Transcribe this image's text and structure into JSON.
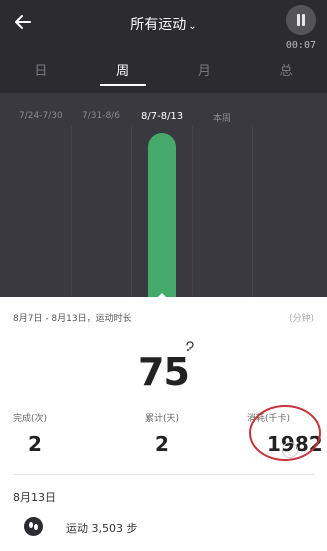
{
  "header": {
    "title": "所有运动",
    "title_chevron": "⌄",
    "timer": "00:07"
  },
  "tabs": [
    {
      "label": "日",
      "active": false
    },
    {
      "label": "周",
      "active": true
    },
    {
      "label": "月",
      "active": false
    },
    {
      "label": "总",
      "active": false
    }
  ],
  "chart_data": {
    "type": "bar",
    "categories": [
      "7/24-7/30",
      "7/31-8/6",
      "8/7-8/13",
      "本周"
    ],
    "values": [
      0,
      0,
      75,
      0
    ],
    "selected": "8/7-8/13",
    "colors": {
      "bar": "#45a96c",
      "background": "#3a393f"
    }
  },
  "summary": {
    "range_label": "8月7日 - 8月13日，运动时长",
    "unit_label": "(分钟)",
    "big_value": "75"
  },
  "stats": [
    {
      "label": "完成(次)",
      "value": "2"
    },
    {
      "label": "累计(天)",
      "value": "2"
    },
    {
      "label": "消耗(千卡)",
      "value": "1982"
    }
  ],
  "day": {
    "date_label": "8月13日",
    "steps_text": "运动 3,503 步"
  }
}
